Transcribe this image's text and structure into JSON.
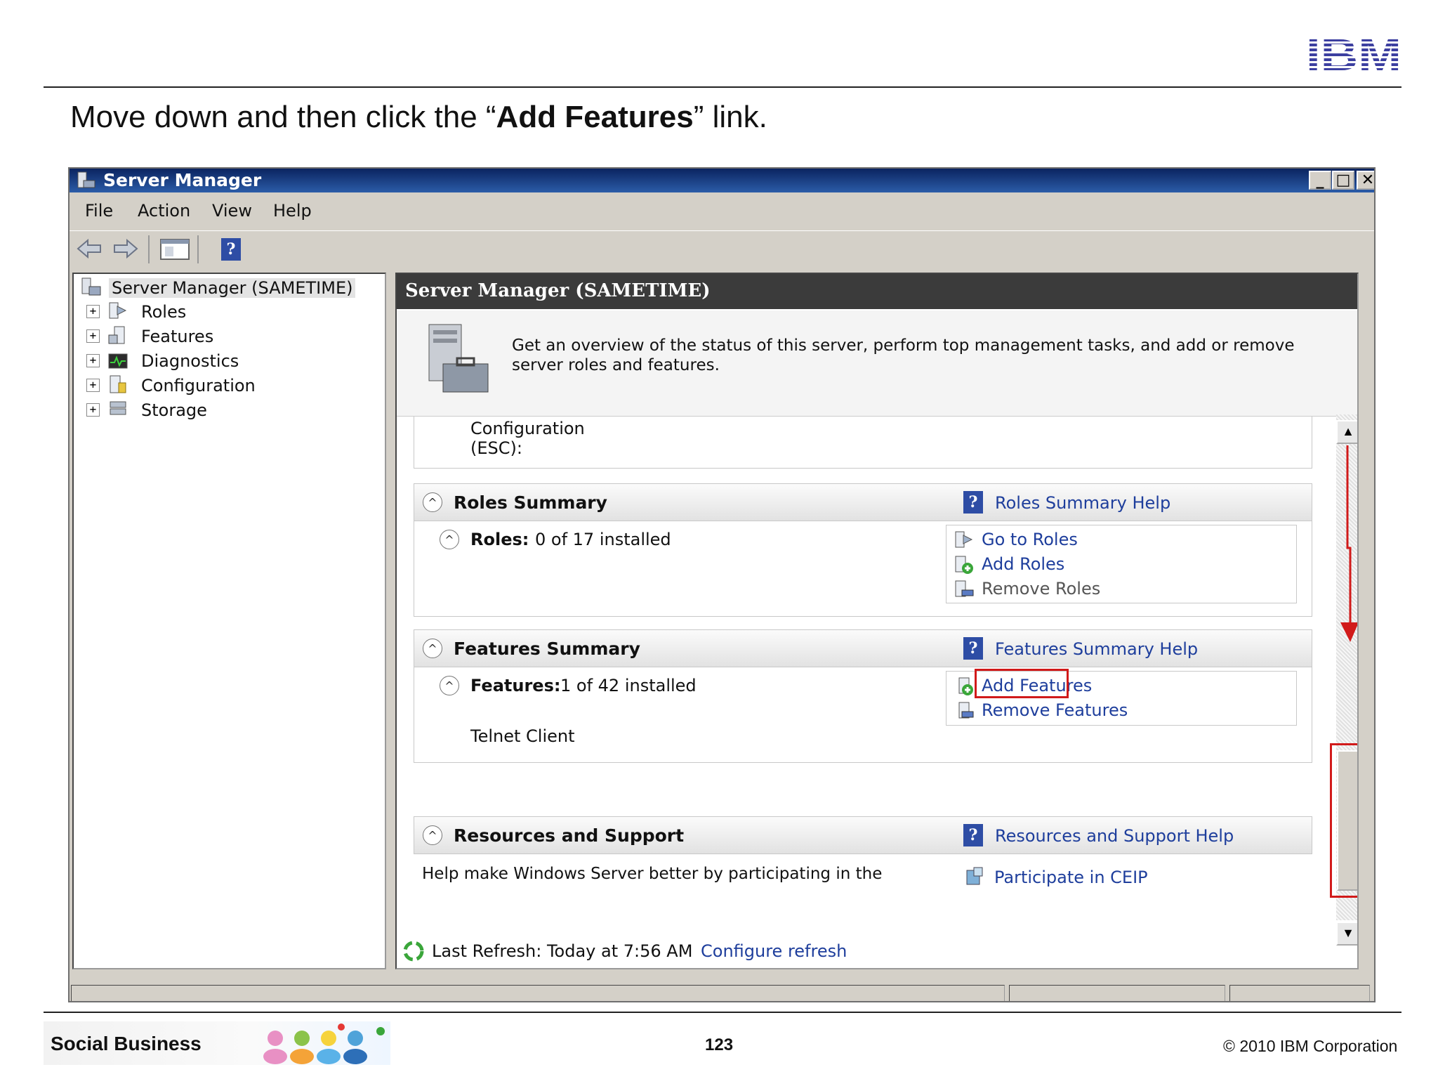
{
  "slide": {
    "instruction_prefix": "Move down and then click the “",
    "instruction_bold": "Add Features",
    "instruction_suffix": "” link.",
    "logo_text": "IBM",
    "footer_left": "Social Business",
    "page_number": "123",
    "copyright": "© 2010 IBM Corporation"
  },
  "window": {
    "title": "Server Manager",
    "controls": {
      "minimize": "_",
      "maximize": "□",
      "close": "✕"
    },
    "menu": [
      "File",
      "Action",
      "View",
      "Help"
    ],
    "toolbar_icons": [
      "back-icon",
      "forward-icon",
      "show-hide-console-tree-icon",
      "help-icon"
    ],
    "tree": {
      "root": "Server Manager (SAMETIME)",
      "items": [
        "Roles",
        "Features",
        "Diagnostics",
        "Configuration",
        "Storage"
      ],
      "expand_glyph": "+"
    },
    "right_header": "Server Manager (SAMETIME)",
    "intro_text": "Get an overview of the status of this server, perform top management tasks, and add or remove server roles and features.",
    "partial_text": [
      "Configuration",
      "(ESC):"
    ],
    "roles_summary": {
      "title": "Roles Summary",
      "help_link": "Roles Summary Help",
      "label": "Roles:",
      "value": "0 of 17 installed",
      "actions": [
        "Go to Roles",
        "Add Roles",
        "Remove Roles"
      ]
    },
    "features_summary": {
      "title": "Features Summary",
      "help_link": "Features Summary Help",
      "label": "Features:",
      "value": "1 of 42 installed",
      "installed": [
        "Telnet Client"
      ],
      "actions": [
        "Add Features",
        "Remove Features"
      ]
    },
    "resources": {
      "title": "Resources and Support",
      "help_link": "Resources and Support Help",
      "text": "Help make Windows Server better by participating in the",
      "action": "Participate in CEIP"
    },
    "refresh": {
      "text": "Last Refresh: Today at 7:56 AM",
      "link": "Configure refresh"
    },
    "help_glyph": "?",
    "collapse_glyph": "^",
    "scroll_up": "▲",
    "scroll_down": "▼"
  },
  "colors": {
    "link": "#1e3e9c",
    "highlight": "#d11a1a",
    "title_bar": "#0b2460",
    "header": "#3b3b3b"
  }
}
